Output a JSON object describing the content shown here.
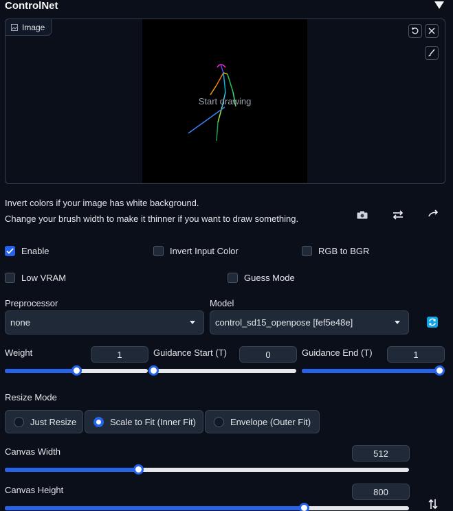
{
  "header": {
    "title": "ControlNet"
  },
  "image_panel": {
    "label": "Image",
    "hint": "Start drawing"
  },
  "info": {
    "line1": "Invert colors if your image has white background.",
    "line2": "Change your brush width to make it thinner if you want to draw something."
  },
  "options": {
    "enable": {
      "label": "Enable",
      "checked": true
    },
    "invert": {
      "label": "Invert Input Color",
      "checked": false
    },
    "rgb_bgr": {
      "label": "RGB to BGR",
      "checked": false
    },
    "low_vram": {
      "label": "Low VRAM",
      "checked": false
    },
    "guess_mode": {
      "label": "Guess Mode",
      "checked": false
    }
  },
  "preprocessor": {
    "label": "Preprocessor",
    "value": "none"
  },
  "model": {
    "label": "Model",
    "value": "control_sd15_openpose [fef5e48e]"
  },
  "weight": {
    "label": "Weight",
    "value": "1",
    "level": 0.5
  },
  "guidance_start": {
    "label": "Guidance Start (T)",
    "value": "0",
    "level": 0.0
  },
  "guidance_end": {
    "label": "Guidance End (T)",
    "value": "1",
    "level": 1.0
  },
  "resize_mode": {
    "label": "Resize Mode",
    "options": [
      "Just Resize",
      "Scale to Fit (Inner Fit)",
      "Envelope (Outer Fit)"
    ],
    "selected": "Scale to Fit (Inner Fit)"
  },
  "canvas_width": {
    "label": "Canvas Width",
    "value": "512",
    "level": 0.33
  },
  "canvas_height": {
    "label": "Canvas Height",
    "value": "800",
    "level": 0.74
  },
  "colors": {
    "accent": "#2563eb",
    "background": "#0b0f19",
    "panel": "#1f2937"
  }
}
